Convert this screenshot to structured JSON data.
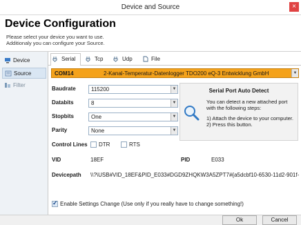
{
  "window": {
    "title": "Device and Source",
    "close_glyph": "×"
  },
  "header": {
    "title": "Device Configuration",
    "line1": "Please select your device you want to use.",
    "line2": "Additionaly you can configure your Source."
  },
  "side_tabs": [
    {
      "label": "Device",
      "icon": "device-icon"
    },
    {
      "label": "Source",
      "icon": "source-icon",
      "active": true
    },
    {
      "label": "Filter",
      "icon": "filter-icon"
    }
  ],
  "top_tabs": [
    {
      "label": "Serial",
      "icon": "plug-icon",
      "active": true
    },
    {
      "label": "Tcp",
      "icon": "plug-icon"
    },
    {
      "label": "Udp",
      "icon": "plug-icon"
    },
    {
      "label": "File",
      "icon": "file-icon"
    }
  ],
  "port": {
    "name": "COM14",
    "description": "2-Kanal-Temperatur-Datenlogger TDO200 eQ-3 Entwicklung GmbH"
  },
  "settings": {
    "baudrate_label": "Baudrate",
    "baudrate_value": "115200",
    "databits_label": "Databits",
    "databits_value": "8",
    "stopbits_label": "Stopbits",
    "stopbits_value": "One",
    "parity_label": "Parity",
    "parity_value": "None"
  },
  "detect": {
    "title": "Serial Port Auto Detect",
    "line1": "You can detect a new attached port",
    "line2": "with the following steps:",
    "line3": "1) Attach the device to your computer.",
    "line4": "2) Press this button."
  },
  "control_lines": {
    "label": "Control Lines",
    "dtr": "DTR",
    "rts": "RTS"
  },
  "info": {
    "vid_label": "VID",
    "vid_value": "18EF",
    "pid_label": "PID",
    "pid_value": "E033",
    "devicepath_label": "Devicepath",
    "devicepath_value": "\\\\?\\USB#VID_18EF&PID_E033#DGD9ZHQKW3A5ZPT7#{a5dcbf10-6530-11d2-901f-..."
  },
  "enable_change": {
    "label": "Enable Settings Change (Use only if you really have to change something!)",
    "checked": true
  },
  "buttons": {
    "ok": "Ok",
    "cancel": "Cancel"
  },
  "colors": {
    "port_highlight": "#f4a21b",
    "close": "#e04343"
  }
}
